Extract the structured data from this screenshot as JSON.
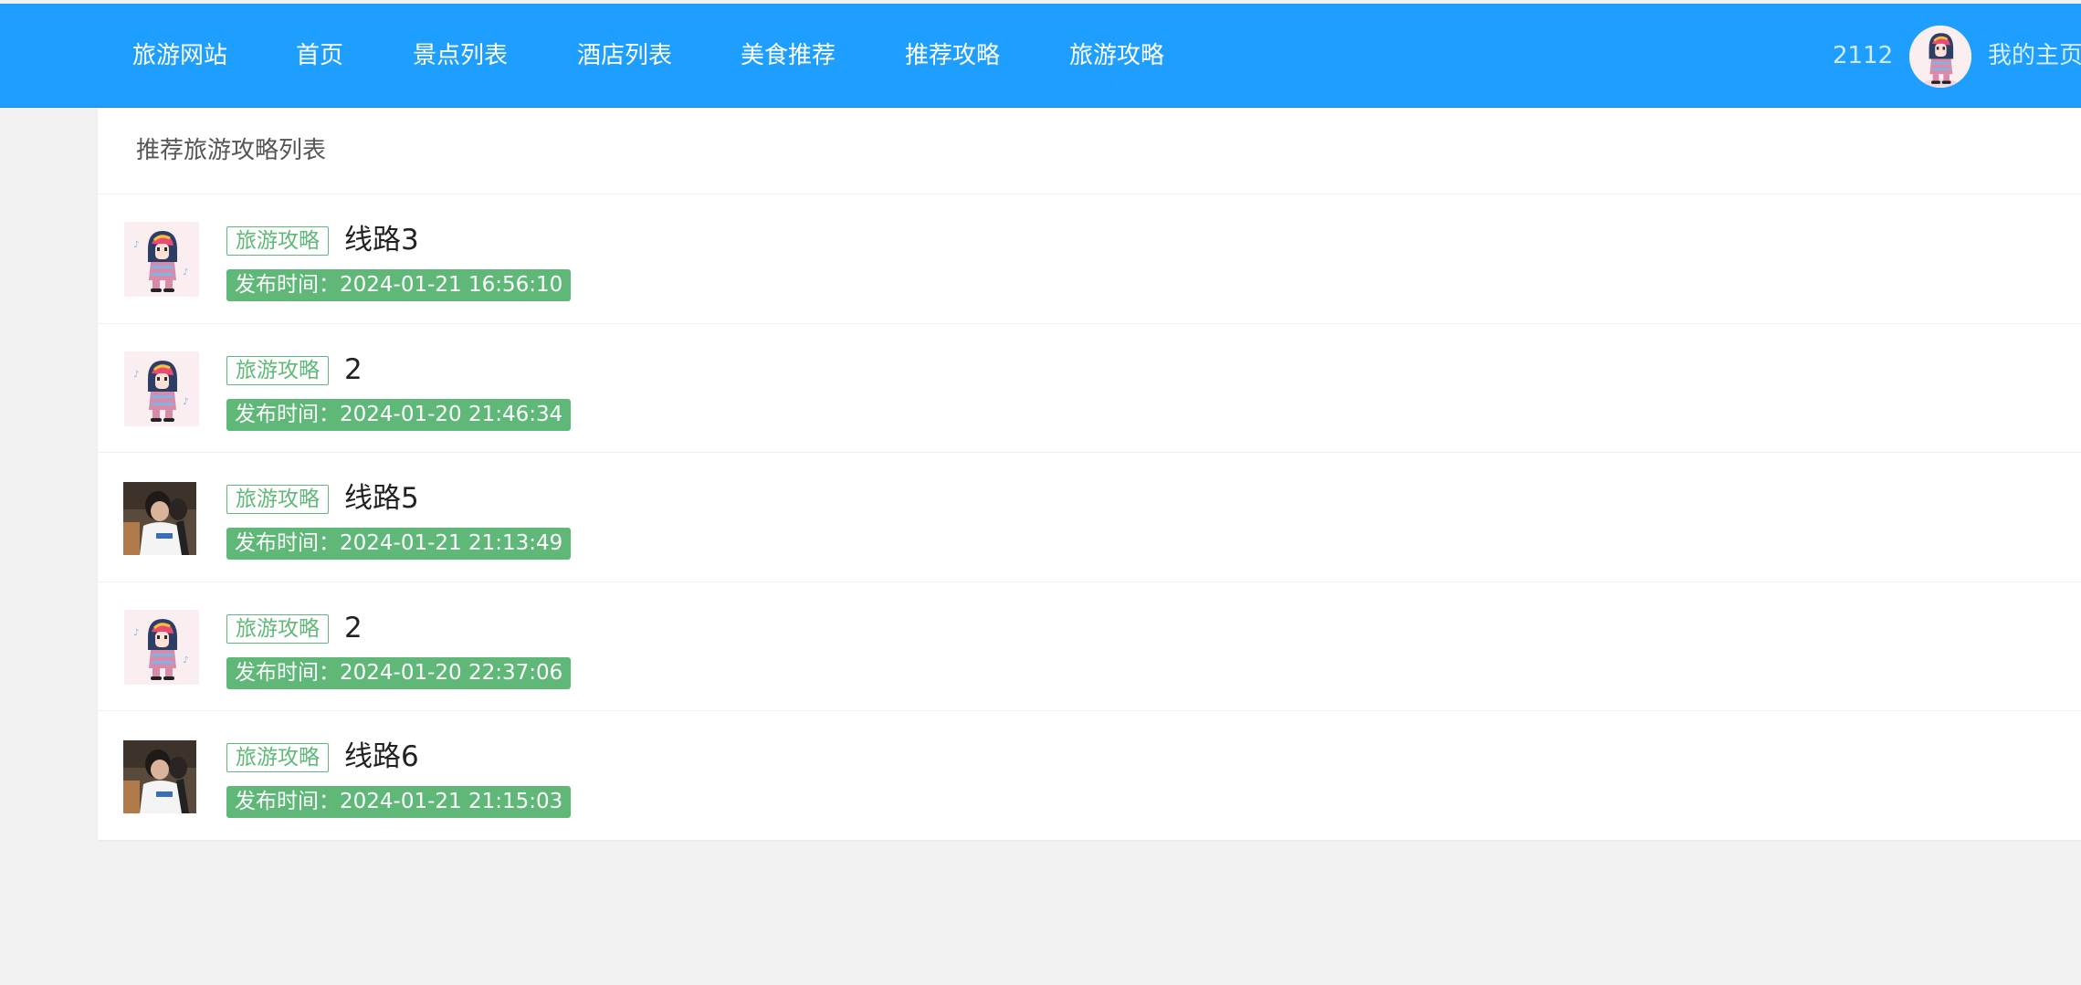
{
  "nav": {
    "brand": "旅游网站",
    "items": [
      {
        "label": "首页"
      },
      {
        "label": "景点列表"
      },
      {
        "label": "酒店列表"
      },
      {
        "label": "美食推荐"
      },
      {
        "label": "推荐攻略"
      },
      {
        "label": "旅游攻略"
      }
    ],
    "user_count": "2112",
    "my_home": "我的主页"
  },
  "panel": {
    "header": "推荐旅游攻略列表"
  },
  "list": [
    {
      "tag": "旅游攻略",
      "title": "线路3",
      "time": "发布时间：2024-01-21 16:56:10",
      "thumb": "cartoon-avatar"
    },
    {
      "tag": "旅游攻略",
      "title": "2",
      "time": "发布时间：2024-01-20 21:46:34",
      "thumb": "cartoon-avatar"
    },
    {
      "tag": "旅游攻略",
      "title": "线路5",
      "time": "发布时间：2024-01-21 21:13:49",
      "thumb": "photo-avatar"
    },
    {
      "tag": "旅游攻略",
      "title": "2",
      "time": "发布时间：2024-01-20 22:37:06",
      "thumb": "cartoon-avatar"
    },
    {
      "tag": "旅游攻略",
      "title": "线路6",
      "time": "发布时间：2024-01-21 21:15:03",
      "thumb": "photo-avatar"
    }
  ],
  "colors": {
    "nav_bg": "#1e9fff",
    "tag_green": "#5fb878",
    "page_bg": "#f2f2f2"
  }
}
